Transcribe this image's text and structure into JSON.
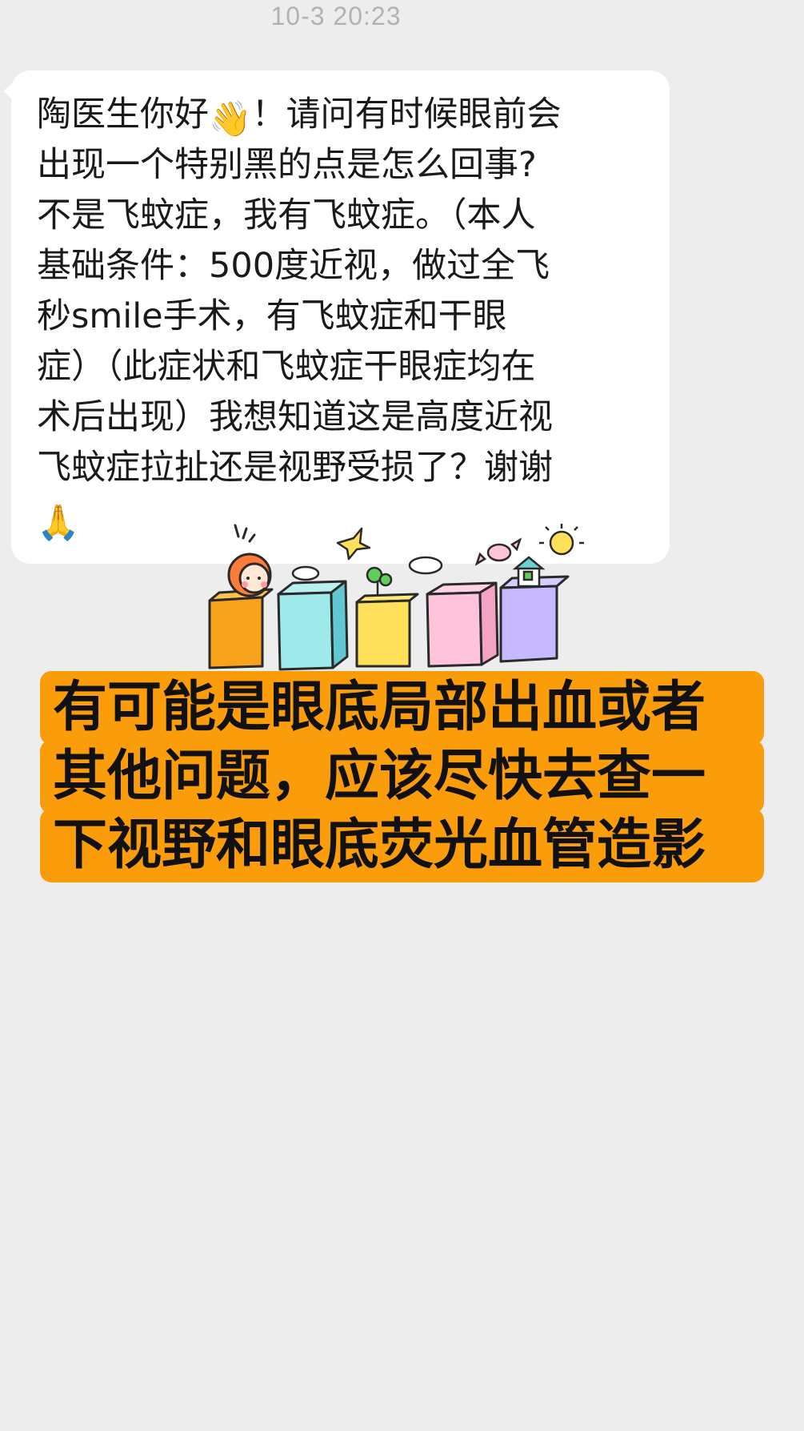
{
  "chat": {
    "timestamp": "10-3 20:23",
    "incoming_message": {
      "lines": [
        "陶医生你好",
        "！请问有时候眼前会",
        "出现一个特别黑的点是怎么回事?",
        "不是飞蚊症，我有飞蚊症。（本人",
        "基础条件：500度近视，做过全飞",
        "秒smile手术，有飞蚊症和干眼",
        "症）（此症状和飞蚊症干眼症均在",
        "术后出现）我想知道这是高度近视",
        "飞蚊症拉扯还是视野受损了？谢谢"
      ],
      "emoji_wave": "👋",
      "emoji_pray": "🙏"
    },
    "sticker": {
      "icon_name": "kid-with-colorful-blocks-sticker"
    },
    "reply_overlay": {
      "lines": [
        "有可能是眼底局部出血或者",
        "其他问题，应该尽快去查一",
        "下视野和眼底荧光血管造影"
      ],
      "background_color": "#fb9d0b"
    }
  }
}
